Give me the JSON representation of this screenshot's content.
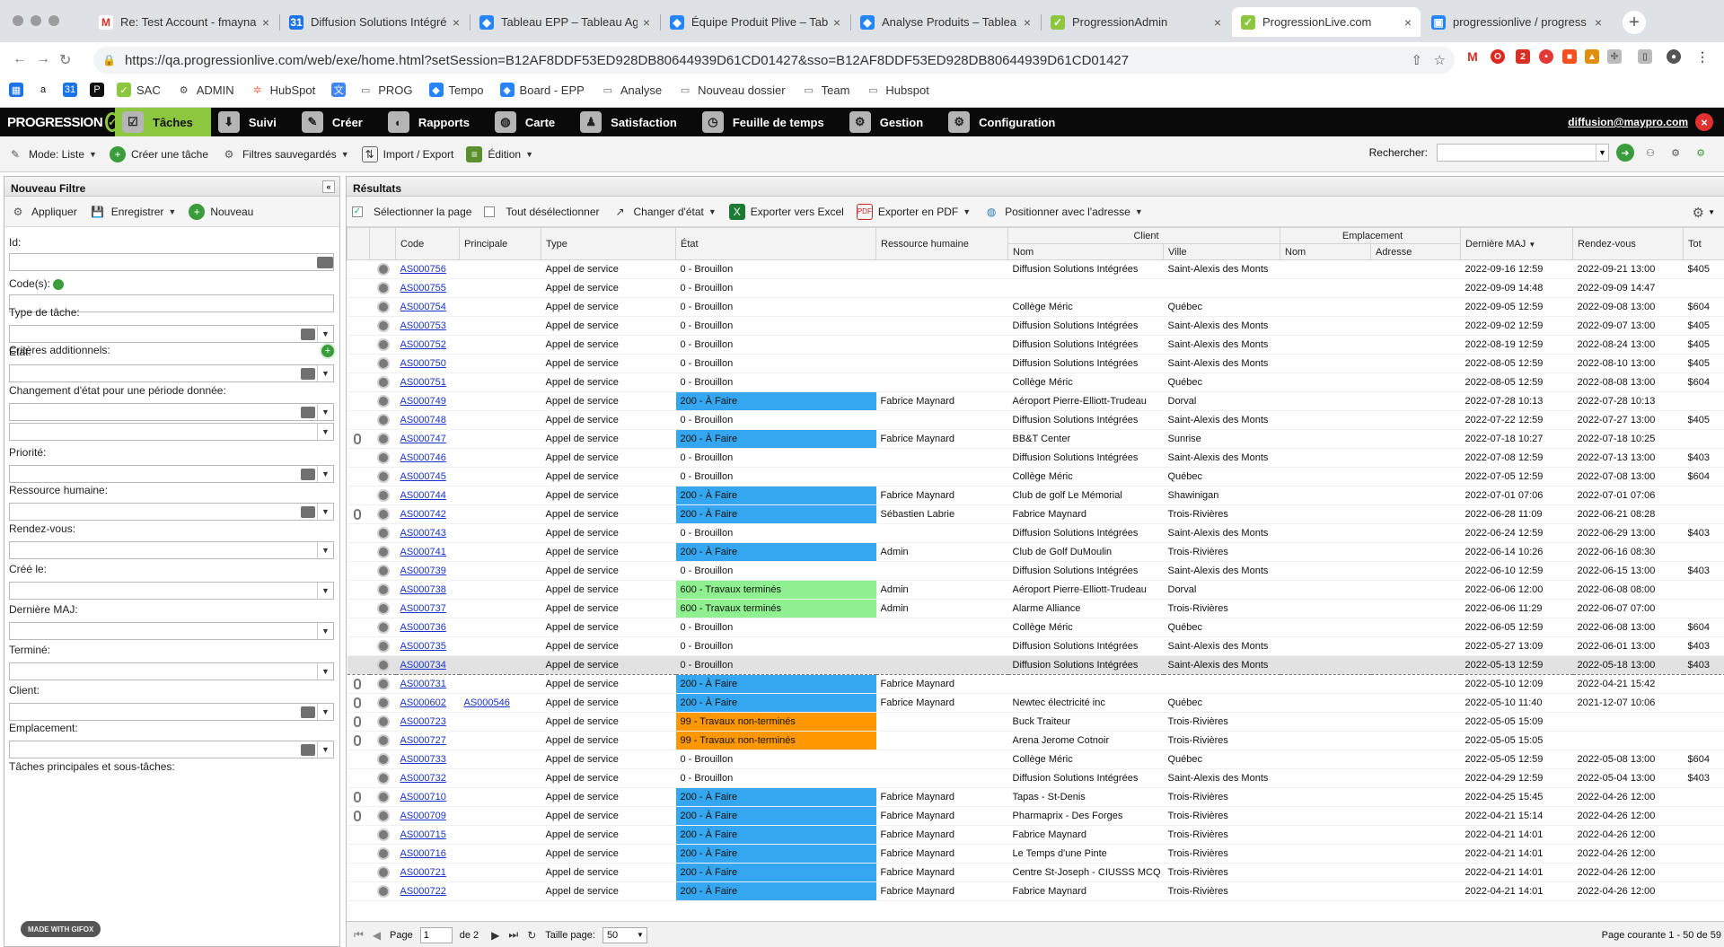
{
  "browser": {
    "tabs": [
      {
        "title": "Re: Test Account - fmayna",
        "icon": "gmail-icon",
        "active": false
      },
      {
        "title": "Diffusion Solutions Intégré",
        "icon": "calendar-icon",
        "active": false
      },
      {
        "title": "Tableau EPP – Tableau Ag",
        "icon": "jira-icon",
        "active": false
      },
      {
        "title": "Équipe Produit Plive – Tab",
        "icon": "jira-icon",
        "active": false
      },
      {
        "title": "Analyse Produits – Tablea",
        "icon": "jira-icon",
        "active": false
      },
      {
        "title": "ProgressionAdmin",
        "icon": "progression-icon",
        "active": false
      },
      {
        "title": "ProgressionLive.com",
        "icon": "progression-icon",
        "active": true
      },
      {
        "title": "progressionlive / progress",
        "icon": "bitbucket-icon",
        "active": false
      }
    ],
    "url": "https://qa.progressionlive.com/web/exe/home.html?setSession=B12AF8DDF53ED928DB80644939D61CD01427&sso=B12AF8DDF53ED928DB80644939D61CD01427",
    "bookmarks": [
      {
        "label": "",
        "icon": "apps-icon"
      },
      {
        "label": "",
        "icon": "amazon-icon"
      },
      {
        "label": "",
        "icon": "calendar-icon"
      },
      {
        "label": "",
        "icon": "p-icon"
      },
      {
        "label": "SAC",
        "icon": "progression-icon"
      },
      {
        "label": "ADMIN",
        "icon": "gear-icon"
      },
      {
        "label": "HubSpot",
        "icon": "hubspot-icon"
      },
      {
        "label": "",
        "icon": "translate-icon"
      },
      {
        "label": "PROG",
        "icon": "folder-icon"
      },
      {
        "label": "Tempo",
        "icon": "jira-icon"
      },
      {
        "label": "Board - EPP",
        "icon": "jira-icon"
      },
      {
        "label": "Analyse",
        "icon": "folder-icon"
      },
      {
        "label": "Nouveau dossier",
        "icon": "folder-icon"
      },
      {
        "label": "Team",
        "icon": "folder-icon"
      },
      {
        "label": "Hubspot",
        "icon": "folder-icon"
      }
    ]
  },
  "app": {
    "logo_text": "PROGRESSION",
    "nav": [
      {
        "label": "Tâches",
        "active": true
      },
      {
        "label": "Suivi",
        "active": false
      },
      {
        "label": "Créer",
        "active": false
      },
      {
        "label": "Rapports",
        "active": false
      },
      {
        "label": "Carte",
        "active": false
      },
      {
        "label": "Satisfaction",
        "active": false
      },
      {
        "label": "Feuille de temps",
        "active": false
      },
      {
        "label": "Gestion",
        "active": false
      },
      {
        "label": "Configuration",
        "active": false
      }
    ],
    "user": "diffusion@maypro.com"
  },
  "toolbar": {
    "mode": "Mode: Liste",
    "create_task": "Créer une tâche",
    "saved_filters": "Filtres sauvegardés",
    "import_export": "Import / Export",
    "edition": "Édition",
    "search_label": "Rechercher:"
  },
  "filter": {
    "title": "Nouveau Filtre",
    "apply": "Appliquer",
    "save": "Enregistrer",
    "new": "Nouveau",
    "id_label": "Id:",
    "codes_label": "Code(s):",
    "additional": "Critères additionnels:",
    "fields": [
      "Type de tâche:",
      "État:",
      "Changement d'état pour une période donnée:",
      "Priorité:",
      "Ressource humaine:",
      "Rendez-vous:",
      "Créé le:",
      "Dernière MAJ:",
      "Terminé:",
      "Client:",
      "Emplacement:",
      "Tâches principales et sous-tâches:"
    ],
    "gifox": "MADE WITH GIFOX"
  },
  "results": {
    "title": "Résultats",
    "select_page": "Sélectionner la page",
    "deselect_all": "Tout désélectionner",
    "change_state": "Changer d'état",
    "export_excel": "Exporter vers Excel",
    "export_pdf": "Exporter en PDF",
    "position": "Positionner avec l'adresse",
    "group_client": "Client",
    "group_location": "Emplacement",
    "columns": {
      "code": "Code",
      "principale": "Principale",
      "type": "Type",
      "etat": "État",
      "ressource": "Ressource humaine",
      "client_nom": "Nom",
      "client_ville": "Ville",
      "empl_nom": "Nom",
      "empl_adresse": "Adresse",
      "maj": "Dernière MAJ",
      "rdv": "Rendez-vous",
      "total": "Tot"
    },
    "rows": [
      {
        "att": false,
        "code": "AS000756",
        "principale": "",
        "type": "Appel de service",
        "etat": "0 - Brouillon",
        "st": "",
        "res": "",
        "client": "Diffusion Solutions Intégrées",
        "ville": "Saint-Alexis des Monts",
        "maj": "2022-09-16 12:59",
        "rdv": "2022-09-21 13:00",
        "total": "$405"
      },
      {
        "att": false,
        "code": "AS000755",
        "principale": "",
        "type": "Appel de service",
        "etat": "0 - Brouillon",
        "st": "",
        "res": "",
        "client": "",
        "ville": "",
        "maj": "2022-09-09 14:48",
        "rdv": "2022-09-09 14:47",
        "total": ""
      },
      {
        "att": false,
        "code": "AS000754",
        "principale": "",
        "type": "Appel de service",
        "etat": "0 - Brouillon",
        "st": "",
        "res": "",
        "client": "Collège Méric",
        "ville": "Québec",
        "maj": "2022-09-05 12:59",
        "rdv": "2022-09-08 13:00",
        "total": "$604"
      },
      {
        "att": false,
        "code": "AS000753",
        "principale": "",
        "type": "Appel de service",
        "etat": "0 - Brouillon",
        "st": "",
        "res": "",
        "client": "Diffusion Solutions Intégrées",
        "ville": "Saint-Alexis des Monts",
        "maj": "2022-09-02 12:59",
        "rdv": "2022-09-07 13:00",
        "total": "$405"
      },
      {
        "att": false,
        "code": "AS000752",
        "principale": "",
        "type": "Appel de service",
        "etat": "0 - Brouillon",
        "st": "",
        "res": "",
        "client": "Diffusion Solutions Intégrées",
        "ville": "Saint-Alexis des Monts",
        "maj": "2022-08-19 12:59",
        "rdv": "2022-08-24 13:00",
        "total": "$405"
      },
      {
        "att": false,
        "code": "AS000750",
        "principale": "",
        "type": "Appel de service",
        "etat": "0 - Brouillon",
        "st": "",
        "res": "",
        "client": "Diffusion Solutions Intégrées",
        "ville": "Saint-Alexis des Monts",
        "maj": "2022-08-05 12:59",
        "rdv": "2022-08-10 13:00",
        "total": "$405"
      },
      {
        "att": false,
        "code": "AS000751",
        "principale": "",
        "type": "Appel de service",
        "etat": "0 - Brouillon",
        "st": "",
        "res": "",
        "client": "Collège Méric",
        "ville": "Québec",
        "maj": "2022-08-05 12:59",
        "rdv": "2022-08-08 13:00",
        "total": "$604"
      },
      {
        "att": false,
        "code": "AS000749",
        "principale": "",
        "type": "Appel de service",
        "etat": "200 - À Faire",
        "st": "st-200",
        "res": "Fabrice Maynard",
        "client": "Aéroport Pierre-Elliott-Trudeau",
        "ville": "Dorval",
        "maj": "2022-07-28 10:13",
        "rdv": "2022-07-28 10:13",
        "total": ""
      },
      {
        "att": false,
        "code": "AS000748",
        "principale": "",
        "type": "Appel de service",
        "etat": "0 - Brouillon",
        "st": "",
        "res": "",
        "client": "Diffusion Solutions Intégrées",
        "ville": "Saint-Alexis des Monts",
        "maj": "2022-07-22 12:59",
        "rdv": "2022-07-27 13:00",
        "total": "$405"
      },
      {
        "att": true,
        "code": "AS000747",
        "principale": "",
        "type": "Appel de service",
        "etat": "200 - À Faire",
        "st": "st-200",
        "res": "Fabrice Maynard",
        "client": "BB&T Center",
        "ville": "Sunrise",
        "maj": "2022-07-18 10:27",
        "rdv": "2022-07-18 10:25",
        "total": ""
      },
      {
        "att": false,
        "code": "AS000746",
        "principale": "",
        "type": "Appel de service",
        "etat": "0 - Brouillon",
        "st": "",
        "res": "",
        "client": "Diffusion Solutions Intégrées",
        "ville": "Saint-Alexis des Monts",
        "maj": "2022-07-08 12:59",
        "rdv": "2022-07-13 13:00",
        "total": "$403"
      },
      {
        "att": false,
        "code": "AS000745",
        "principale": "",
        "type": "Appel de service",
        "etat": "0 - Brouillon",
        "st": "",
        "res": "",
        "client": "Collège Méric",
        "ville": "Québec",
        "maj": "2022-07-05 12:59",
        "rdv": "2022-07-08 13:00",
        "total": "$604"
      },
      {
        "att": false,
        "code": "AS000744",
        "principale": "",
        "type": "Appel de service",
        "etat": "200 - À Faire",
        "st": "st-200",
        "res": "Fabrice Maynard",
        "client": "Club de golf Le Mémorial",
        "ville": "Shawinigan",
        "maj": "2022-07-01 07:06",
        "rdv": "2022-07-01 07:06",
        "total": ""
      },
      {
        "att": true,
        "code": "AS000742",
        "principale": "",
        "type": "Appel de service",
        "etat": "200 - À Faire",
        "st": "st-200",
        "res": "Sébastien Labrie",
        "client": "Fabrice Maynard",
        "ville": "Trois-Rivières",
        "maj": "2022-06-28 11:09",
        "rdv": "2022-06-21 08:28",
        "total": ""
      },
      {
        "att": false,
        "code": "AS000743",
        "principale": "",
        "type": "Appel de service",
        "etat": "0 - Brouillon",
        "st": "",
        "res": "",
        "client": "Diffusion Solutions Intégrées",
        "ville": "Saint-Alexis des Monts",
        "maj": "2022-06-24 12:59",
        "rdv": "2022-06-29 13:00",
        "total": "$403"
      },
      {
        "att": false,
        "code": "AS000741",
        "principale": "",
        "type": "Appel de service",
        "etat": "200 - À Faire",
        "st": "st-200",
        "res": "Admin",
        "client": "Club de Golf DuMoulin",
        "ville": "Trois-Rivières",
        "maj": "2022-06-14 10:26",
        "rdv": "2022-06-16 08:30",
        "total": ""
      },
      {
        "att": false,
        "code": "AS000739",
        "principale": "",
        "type": "Appel de service",
        "etat": "0 - Brouillon",
        "st": "",
        "res": "",
        "client": "Diffusion Solutions Intégrées",
        "ville": "Saint-Alexis des Monts",
        "maj": "2022-06-10 12:59",
        "rdv": "2022-06-15 13:00",
        "total": "$403"
      },
      {
        "att": false,
        "code": "AS000738",
        "principale": "",
        "type": "Appel de service",
        "etat": "600 - Travaux terminés",
        "st": "st-600",
        "res": "Admin",
        "client": "Aéroport Pierre-Elliott-Trudeau",
        "ville": "Dorval",
        "maj": "2022-06-06 12:00",
        "rdv": "2022-06-08 08:00",
        "total": ""
      },
      {
        "att": false,
        "code": "AS000737",
        "principale": "",
        "type": "Appel de service",
        "etat": "600 - Travaux terminés",
        "st": "st-600",
        "res": "Admin",
        "client": "Alarme Alliance",
        "ville": "Trois-Rivières",
        "maj": "2022-06-06 11:29",
        "rdv": "2022-06-07 07:00",
        "total": ""
      },
      {
        "att": false,
        "code": "AS000736",
        "principale": "",
        "type": "Appel de service",
        "etat": "0 - Brouillon",
        "st": "",
        "res": "",
        "client": "Collège Méric",
        "ville": "Québec",
        "maj": "2022-06-05 12:59",
        "rdv": "2022-06-08 13:00",
        "total": "$604"
      },
      {
        "att": false,
        "code": "AS000735",
        "principale": "",
        "type": "Appel de service",
        "etat": "0 - Brouillon",
        "st": "",
        "res": "",
        "client": "Diffusion Solutions Intégrées",
        "ville": "Saint-Alexis des Monts",
        "maj": "2022-05-27 13:09",
        "rdv": "2022-06-01 13:00",
        "total": "$403"
      },
      {
        "att": false,
        "code": "AS000734",
        "principale": "",
        "type": "Appel de service",
        "etat": "0 - Brouillon",
        "st": "",
        "res": "",
        "client": "Diffusion Solutions Intégrées",
        "ville": "Saint-Alexis des Monts",
        "maj": "2022-05-13 12:59",
        "rdv": "2022-05-18 13:00",
        "total": "$403",
        "sel": true
      },
      {
        "att": true,
        "code": "AS000731",
        "principale": "",
        "type": "Appel de service",
        "etat": "200 - À Faire",
        "st": "st-200",
        "res": "Fabrice Maynard",
        "client": "",
        "ville": "",
        "maj": "2022-05-10 12:09",
        "rdv": "2022-04-21 15:42",
        "total": ""
      },
      {
        "att": true,
        "code": "AS000602",
        "principale": "AS000546",
        "type": "Appel de service",
        "etat": "200 - À Faire",
        "st": "st-200",
        "res": "Fabrice Maynard",
        "client": "Newtec électricité inc",
        "ville": "Québec",
        "maj": "2022-05-10 11:40",
        "rdv": "2021-12-07 10:06",
        "total": ""
      },
      {
        "att": true,
        "code": "AS000723",
        "principale": "",
        "type": "Appel de service",
        "etat": "99 - Travaux non-terminés",
        "st": "st-99",
        "res": "",
        "client": "Buck Traiteur",
        "ville": "Trois-Rivières",
        "maj": "2022-05-05 15:09",
        "rdv": "",
        "total": ""
      },
      {
        "att": true,
        "code": "AS000727",
        "principale": "",
        "type": "Appel de service",
        "etat": "99 - Travaux non-terminés",
        "st": "st-99",
        "res": "",
        "client": "Arena Jerome Cotnoir",
        "ville": "Trois-Rivières",
        "maj": "2022-05-05 15:05",
        "rdv": "",
        "total": ""
      },
      {
        "att": false,
        "code": "AS000733",
        "principale": "",
        "type": "Appel de service",
        "etat": "0 - Brouillon",
        "st": "",
        "res": "",
        "client": "Collège Méric",
        "ville": "Québec",
        "maj": "2022-05-05 12:59",
        "rdv": "2022-05-08 13:00",
        "total": "$604"
      },
      {
        "att": false,
        "code": "AS000732",
        "principale": "",
        "type": "Appel de service",
        "etat": "0 - Brouillon",
        "st": "",
        "res": "",
        "client": "Diffusion Solutions Intégrées",
        "ville": "Saint-Alexis des Monts",
        "maj": "2022-04-29 12:59",
        "rdv": "2022-05-04 13:00",
        "total": "$403"
      },
      {
        "att": true,
        "code": "AS000710",
        "principale": "",
        "type": "Appel de service",
        "etat": "200 - À Faire",
        "st": "st-200",
        "res": "Fabrice Maynard",
        "client": "Tapas - St-Denis",
        "ville": "Trois-Rivières",
        "maj": "2022-04-25 15:45",
        "rdv": "2022-04-26 12:00",
        "total": ""
      },
      {
        "att": true,
        "code": "AS000709",
        "principale": "",
        "type": "Appel de service",
        "etat": "200 - À Faire",
        "st": "st-200",
        "res": "Fabrice Maynard",
        "client": "Pharmaprix - Des Forges",
        "ville": "Trois-Rivières",
        "maj": "2022-04-21 15:14",
        "rdv": "2022-04-26 12:00",
        "total": ""
      },
      {
        "att": false,
        "code": "AS000715",
        "principale": "",
        "type": "Appel de service",
        "etat": "200 - À Faire",
        "st": "st-200",
        "res": "Fabrice Maynard",
        "client": "Fabrice Maynard",
        "ville": "Trois-Rivières",
        "maj": "2022-04-21 14:01",
        "rdv": "2022-04-26 12:00",
        "total": ""
      },
      {
        "att": false,
        "code": "AS000716",
        "principale": "",
        "type": "Appel de service",
        "etat": "200 - À Faire",
        "st": "st-200",
        "res": "Fabrice Maynard",
        "client": "Le Temps d'une Pinte",
        "ville": "Trois-Rivières",
        "maj": "2022-04-21 14:01",
        "rdv": "2022-04-26 12:00",
        "total": ""
      },
      {
        "att": false,
        "code": "AS000721",
        "principale": "",
        "type": "Appel de service",
        "etat": "200 - À Faire",
        "st": "st-200",
        "res": "Fabrice Maynard",
        "client": "Centre St-Joseph - CIUSSS MCQ",
        "ville": "Trois-Rivières",
        "maj": "2022-04-21 14:01",
        "rdv": "2022-04-26 12:00",
        "total": ""
      },
      {
        "att": false,
        "code": "AS000722",
        "principale": "",
        "type": "Appel de service",
        "etat": "200 - À Faire",
        "st": "st-200",
        "res": "Fabrice Maynard",
        "client": "Fabrice Maynard",
        "ville": "Trois-Rivières",
        "maj": "2022-04-21 14:01",
        "rdv": "2022-04-26 12:00",
        "total": ""
      }
    ],
    "pager": {
      "page_label": "Page",
      "page_value": "1",
      "of": "de 2",
      "size_label": "Taille page:",
      "size_value": "50",
      "info": "Page courante 1 - 50 de 59"
    }
  }
}
